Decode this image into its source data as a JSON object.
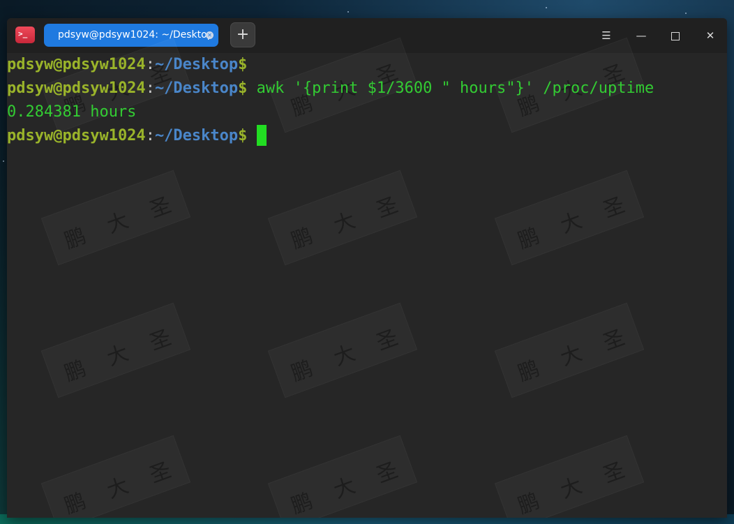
{
  "window": {
    "tab_title": "pdsyw@pdsyw1024: ~/Desktop",
    "new_tab_label": "+"
  },
  "terminal": {
    "lines": [
      {
        "user": "pdsyw@pdsyw1024",
        "colon": ":",
        "path": "~/Desktop",
        "dollar": "$",
        "command": ""
      },
      {
        "user": "pdsyw@pdsyw1024",
        "colon": ":",
        "path": "~/Desktop",
        "dollar": "$",
        "command": " awk '{print $1/3600 \" hours\"}' /proc/uptime"
      },
      {
        "output": "0.284381 hours"
      },
      {
        "user": "pdsyw@pdsyw1024",
        "colon": ":",
        "path": "~/Desktop",
        "dollar": "$",
        "command": " "
      }
    ]
  },
  "colors": {
    "prompt_user": "#9ab42a",
    "prompt_path": "#4a86c9",
    "command": "#33cc33",
    "tab_active": "#1f7ae0"
  },
  "icons": {
    "app": "terminal-icon",
    "menu": "hamburger-icon",
    "minimize": "minimize-icon",
    "maximize": "maximize-icon",
    "close": "close-icon"
  }
}
